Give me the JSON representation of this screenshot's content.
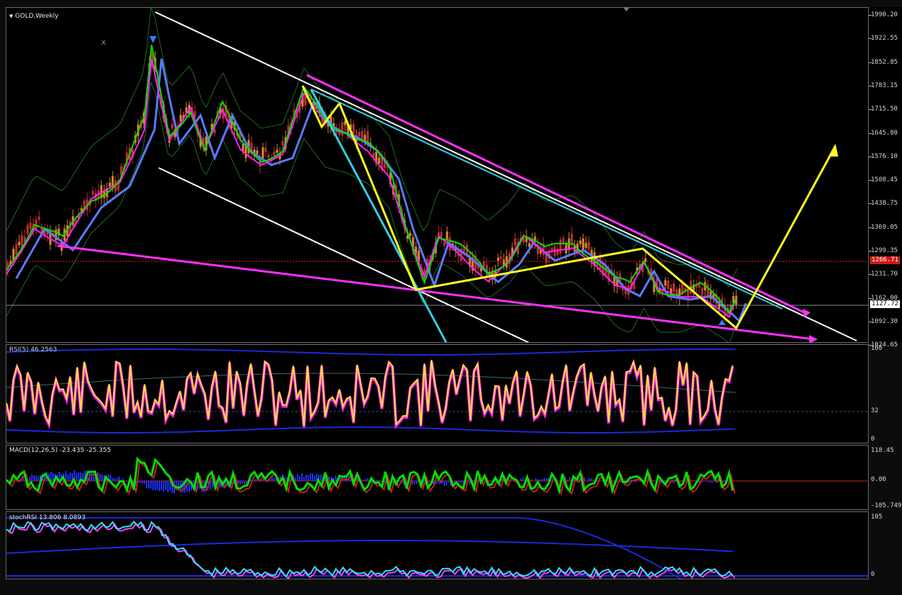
{
  "chart_title": "GOLD,Weekly",
  "close_marker": "x",
  "colors": {
    "background": "#000000",
    "bull_candle": "#e08a2a",
    "bear_candle": "#c03030",
    "fast_ma": "#00e000",
    "slow_ma": "#ff20ff",
    "mid_ma": "#5b7bff",
    "bands": "#1f6b1f",
    "trend_white": "#ffffff",
    "trend_magenta": "#ff30ff",
    "trend_cyan": "#33d0e0",
    "pattern_yellow": "#ffff20",
    "bid_line": "#ff2020",
    "rsi_line": "#ffe030",
    "macd_hist": "#2030ff",
    "stoch_line": "#30e0ff"
  },
  "main_scale": [
    "1990.20",
    "1922.55",
    "1852.85",
    "1783.15",
    "1715.50",
    "1645.80",
    "1576.10",
    "1508.45",
    "1438.75",
    "1369.05",
    "1299.35",
    "1231.70",
    "1162.00",
    "1092.30",
    "1024.65"
  ],
  "bid_price": "1266.71",
  "current_price": "1127.72",
  "rsi": {
    "label": "RSI(5) 46.2563",
    "scale": [
      "100",
      "32",
      "0"
    ]
  },
  "macd": {
    "label": "MACD(12,26,5) -23.435 -25.355",
    "scale": [
      "118.45",
      "0.00",
      "-105.749"
    ]
  },
  "stoch": {
    "label": "stochRSI 13.806 8.0893",
    "scale": [
      "105",
      "0"
    ]
  }
}
